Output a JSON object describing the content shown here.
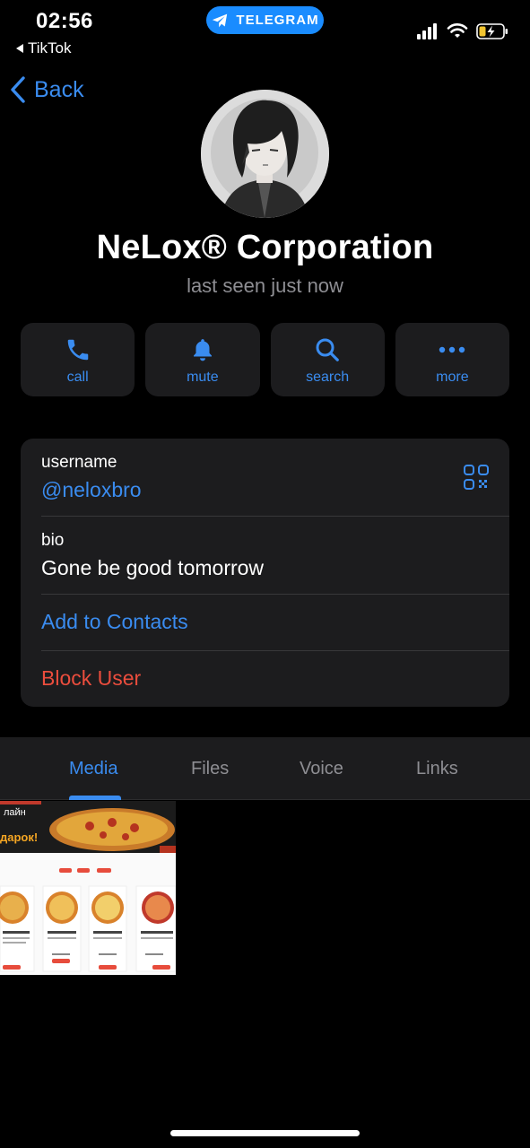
{
  "status_bar": {
    "time": "02:56",
    "back_app": "TikTok",
    "pill_label": "TELEGRAM",
    "icons": [
      "signal-icon",
      "wifi-icon",
      "battery-charging-icon"
    ]
  },
  "nav": {
    "back_label": "Back"
  },
  "profile": {
    "name": "NeLox® Corporation",
    "status": "last seen just now"
  },
  "actions": [
    {
      "label": "call",
      "icon": "phone-icon"
    },
    {
      "label": "mute",
      "icon": "bell-icon"
    },
    {
      "label": "search",
      "icon": "search-icon"
    },
    {
      "label": "more",
      "icon": "more-icon"
    }
  ],
  "info": {
    "username_label": "username",
    "username_value": "@neloxbro",
    "bio_label": "bio",
    "bio_value": "Gone be good tomorrow",
    "add_contacts": "Add to Contacts",
    "block_user": "Block User"
  },
  "tabs": [
    {
      "label": "Media",
      "active": true
    },
    {
      "label": "Files",
      "active": false
    },
    {
      "label": "Voice",
      "active": false
    },
    {
      "label": "Links",
      "active": false
    }
  ],
  "media": {
    "thumb_texts": {
      "headline_1": "лайн",
      "headline_2": "дарок!"
    }
  },
  "colors": {
    "accent": "#3a8cf0",
    "danger": "#eb4d3d",
    "card_bg": "#1c1c1e",
    "secondary_text": "#8e8e93",
    "telegram_pill": "#1a8cff"
  }
}
